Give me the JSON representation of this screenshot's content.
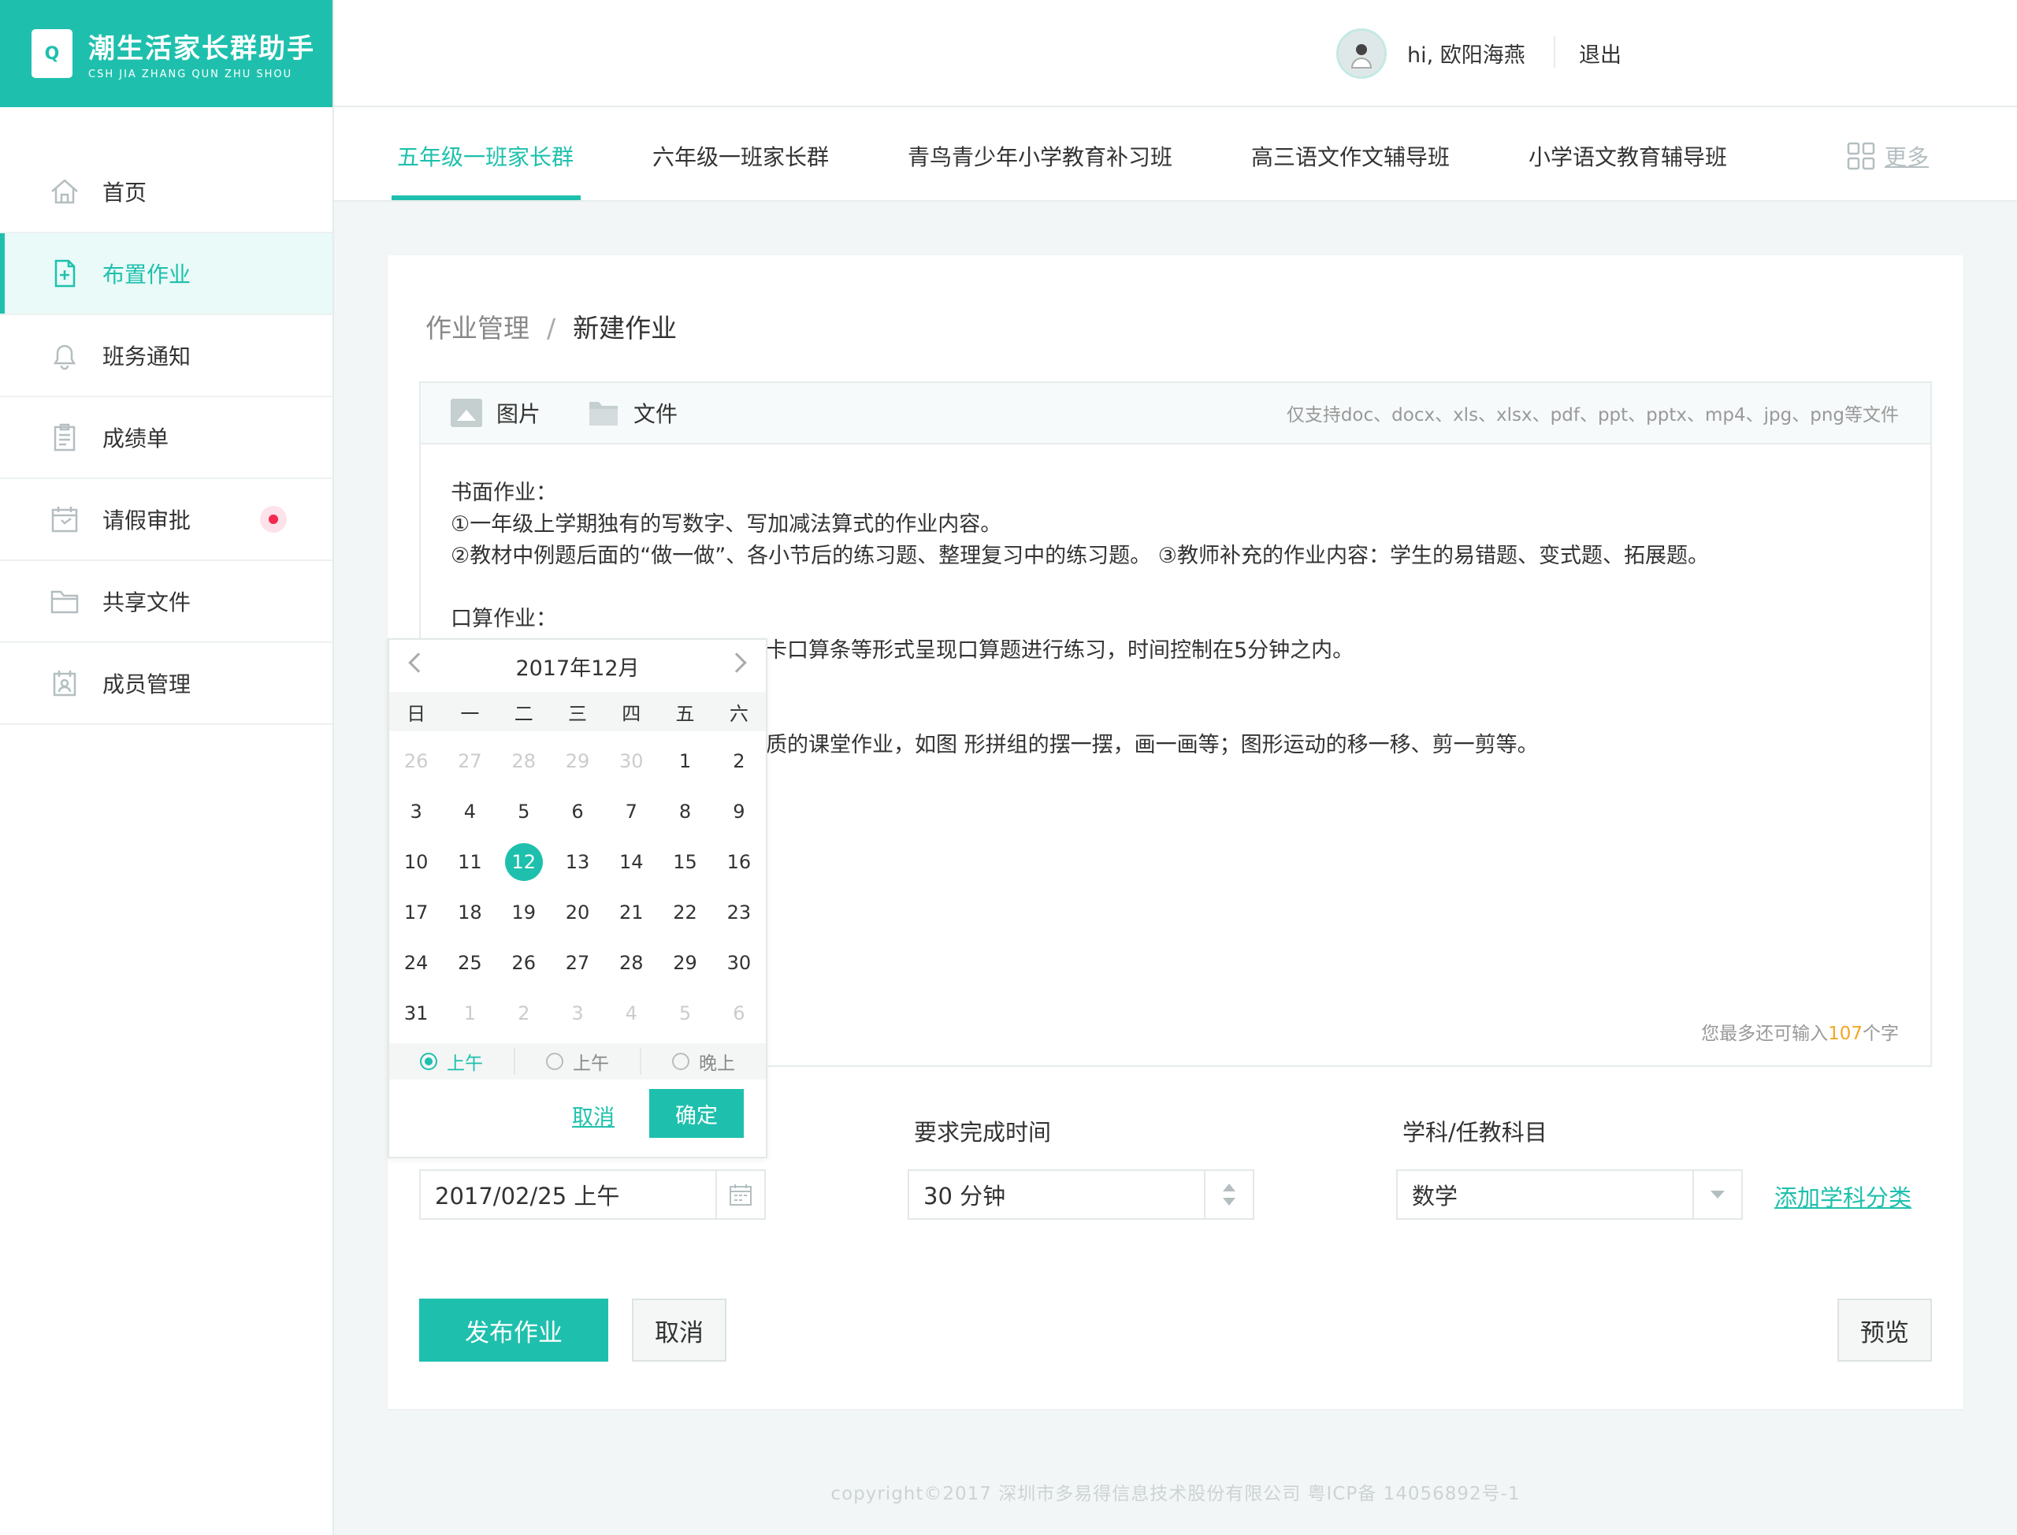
{
  "app": {
    "name": "潮生活家长群助手",
    "subtitle": "CSH JIA ZHANG QUN ZHU SHOU",
    "logo_letter": "Q"
  },
  "header": {
    "greeting": "hi, 欧阳海燕",
    "logout": "退出"
  },
  "sidebar": {
    "items": [
      {
        "label": "首页",
        "icon": "home-icon"
      },
      {
        "label": "布置作业",
        "icon": "assignment-icon",
        "active": true
      },
      {
        "label": "班务通知",
        "icon": "bell-icon"
      },
      {
        "label": "成绩单",
        "icon": "clipboard-icon"
      },
      {
        "label": "请假审批",
        "icon": "calendar-icon",
        "badge": true
      },
      {
        "label": "共享文件",
        "icon": "folder-icon"
      },
      {
        "label": "成员管理",
        "icon": "contacts-icon"
      }
    ]
  },
  "tabs": {
    "items": [
      "五年级一班家长群",
      "六年级一班家长群",
      "青鸟青少年小学教育补习班",
      "高三语文作文辅导班",
      "小学语文教育辅导班"
    ],
    "active_index": 0,
    "more": "更多"
  },
  "breadcrumb": {
    "parent": "作业管理",
    "separator": "/",
    "current": "新建作业"
  },
  "editor": {
    "image_button": "图片",
    "file_button": "文件",
    "hint": "仅支持doc、docx、xls、xlsx、pdf、ppt、pptx、mp4、jpg、png等文件",
    "lines": [
      "书面作业：",
      "①一年级上学期独有的写数字、写加减法算式的作业内容。",
      "②教材中例题后面的“做一做”、各小节后的练习题、整理复习中的练习题。 ③教师补充的作业内容：学生的易错题、变式题、拓展题。",
      "",
      "口算作业：",
      "卡口算条等形式呈现口算题进行练习，时间控制在5分钟之内。",
      "",
      "质的课堂作业，如图 形拼组的摆一摆，画一画等；图形运动的移一移、剪一剪等。"
    ],
    "counter_prefix": "您最多还可输入",
    "counter_value": "107",
    "counter_suffix": "个字"
  },
  "form": {
    "date_value": "2017/02/25 上午",
    "duration_label": "要求完成时间",
    "duration_value": "30 分钟",
    "subject_label": "学科/任教科目",
    "subject_value": "数学",
    "add_category": "添加学科分类"
  },
  "actions": {
    "publish": "发布作业",
    "cancel": "取消",
    "preview": "预览"
  },
  "datepicker": {
    "title": "2017年12月",
    "weekdays": [
      "日",
      "一",
      "二",
      "三",
      "四",
      "五",
      "六"
    ],
    "days": [
      {
        "d": "26",
        "m": true
      },
      {
        "d": "27",
        "m": true
      },
      {
        "d": "28",
        "m": true
      },
      {
        "d": "29",
        "m": true
      },
      {
        "d": "30",
        "m": true
      },
      {
        "d": "1"
      },
      {
        "d": "2"
      },
      {
        "d": "3"
      },
      {
        "d": "4"
      },
      {
        "d": "5"
      },
      {
        "d": "6"
      },
      {
        "d": "7"
      },
      {
        "d": "8"
      },
      {
        "d": "9"
      },
      {
        "d": "10"
      },
      {
        "d": "11"
      },
      {
        "d": "12",
        "sel": true
      },
      {
        "d": "13"
      },
      {
        "d": "14"
      },
      {
        "d": "15"
      },
      {
        "d": "16"
      },
      {
        "d": "17"
      },
      {
        "d": "18"
      },
      {
        "d": "19"
      },
      {
        "d": "20"
      },
      {
        "d": "21"
      },
      {
        "d": "22"
      },
      {
        "d": "23"
      },
      {
        "d": "24"
      },
      {
        "d": "25"
      },
      {
        "d": "26"
      },
      {
        "d": "27"
      },
      {
        "d": "28"
      },
      {
        "d": "29"
      },
      {
        "d": "30"
      },
      {
        "d": "31"
      },
      {
        "d": "1",
        "m": true
      },
      {
        "d": "2",
        "m": true
      },
      {
        "d": "3",
        "m": true
      },
      {
        "d": "4",
        "m": true
      },
      {
        "d": "5",
        "m": true
      },
      {
        "d": "6",
        "m": true
      }
    ],
    "periods": [
      "上午",
      "上午",
      "晚上"
    ],
    "selected_period": 0,
    "cancel": "取消",
    "confirm": "确定"
  },
  "footer": {
    "copyright": "copyright©2017  深圳市多易得信息技术股份有限公司      粤ICP备 14056892号-1"
  },
  "colors": {
    "accent": "#1ec0ad",
    "badge": "#f3294f",
    "counter_highlight": "#f5a623"
  }
}
